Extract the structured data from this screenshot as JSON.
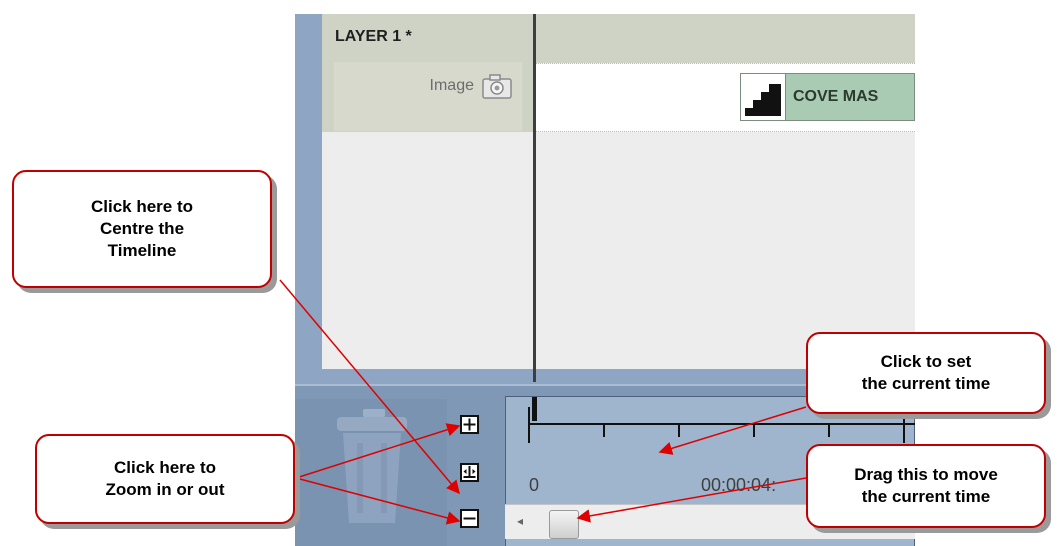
{
  "layer": {
    "title": "LAYER 1 *",
    "row_label": "Image",
    "clip_label": "COVE MAS"
  },
  "timeline": {
    "start_label": "0",
    "time_label": "00:00:04:",
    "zoom_in_symbol": "+",
    "centre_symbol": "⊥",
    "zoom_out_symbol": "−",
    "scroll_left_symbol": "◂"
  },
  "callouts": {
    "centre": "Click here to\nCentre the\nTimeline",
    "zoom": "Click here to\nZoom in or out",
    "set_time": "Click to set\nthe current time",
    "drag_time": "Drag this to move\nthe current time"
  },
  "colors": {
    "callout_border": "#c00000",
    "arrow": "#e00000",
    "app_background": "#8ea6c3",
    "clip": "#a9cbb4"
  },
  "icons": [
    "camera-icon",
    "trash-icon",
    "zoom-in-icon",
    "centre-timeline-icon",
    "zoom-out-icon",
    "scroll-left-icon"
  ]
}
